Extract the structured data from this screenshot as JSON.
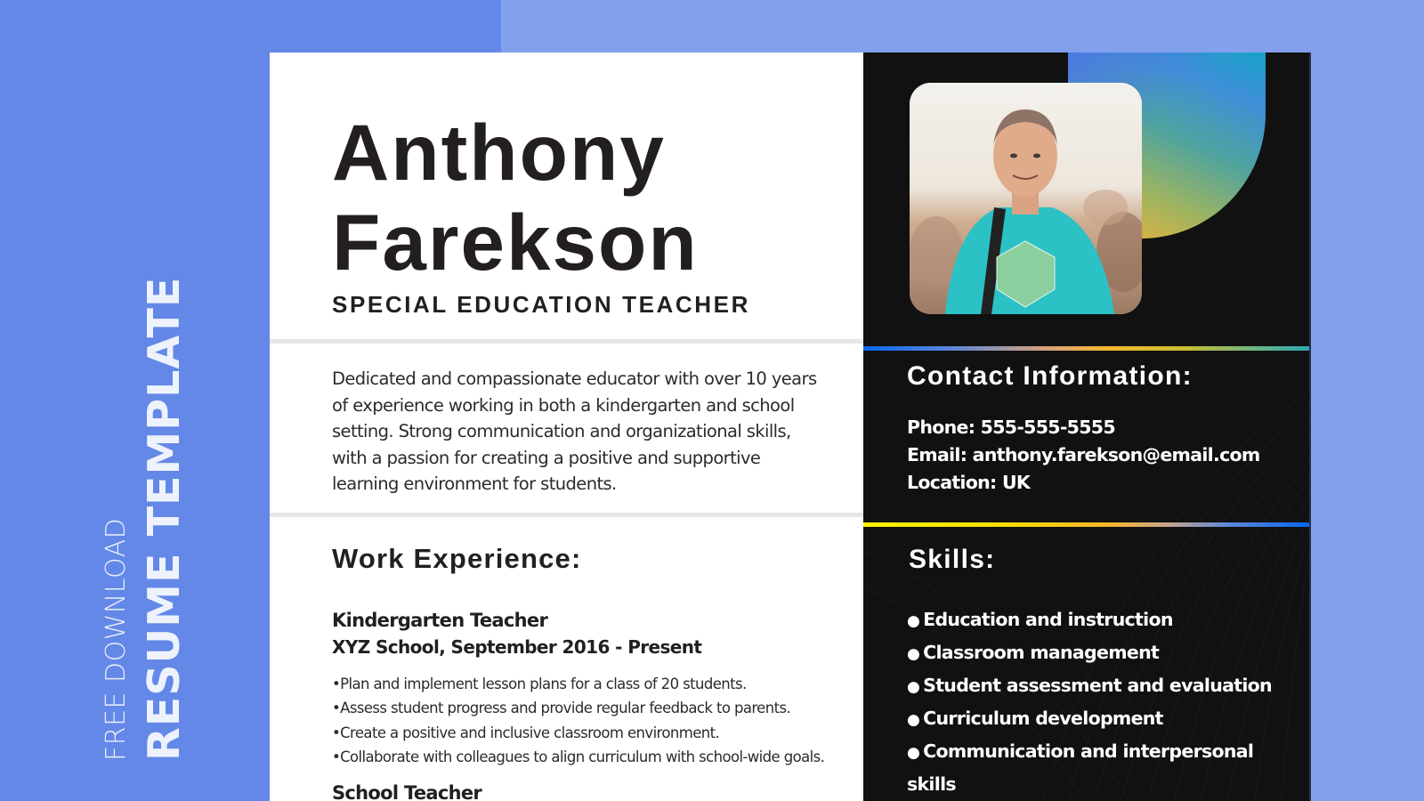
{
  "banner": {
    "line1": "FREE DOWNLOAD",
    "line2": "RESUME TEMPLATE"
  },
  "resume": {
    "first_name": "Anthony",
    "last_name": "Farekson",
    "job_title": "SPECIAL EDUCATION TEACHER",
    "summary": "Dedicated and compassionate educator with over 10 years of experience working in both a kindergarten and school setting. Strong communication and organizational skills, with a passion for creating a positive and supportive learning environment for students.",
    "photo_alt": "Portrait photo of a smiling man in a turquoise t-shirt",
    "work_experience": {
      "heading": "Work Experience:",
      "jobs": [
        {
          "role": "Kindergarten Teacher",
          "meta": "XYZ School, September 2016 - Present",
          "bullets": [
            "Plan and implement lesson plans for a class of 20 students.",
            "Assess student progress and provide regular feedback to parents.",
            "Create a positive and inclusive classroom environment.",
            "Collaborate with colleagues to align curriculum with school-wide goals."
          ]
        },
        {
          "role": "School Teacher"
        }
      ]
    },
    "contact": {
      "heading": "Contact Information:",
      "phone": "Phone: 555-555-5555",
      "email": "Email: anthony.farekson@email.com",
      "location": "Location: UK"
    },
    "skills": {
      "heading": "Skills:",
      "items": [
        "Education and instruction",
        "Classroom management",
        "Student assessment and evaluation",
        "Curriculum development",
        "Communication and interpersonal skills"
      ]
    }
  },
  "colors": {
    "background_blue": "#6388e7",
    "background_light_blue": "#82a0ec",
    "dark_panel": "#111111",
    "text_dark": "#231f20",
    "accent_yellow": "#fff200",
    "accent_blue": "#0a67f2",
    "accent_orange": "#f9b22e",
    "accent_teal": "#17a2c8"
  }
}
